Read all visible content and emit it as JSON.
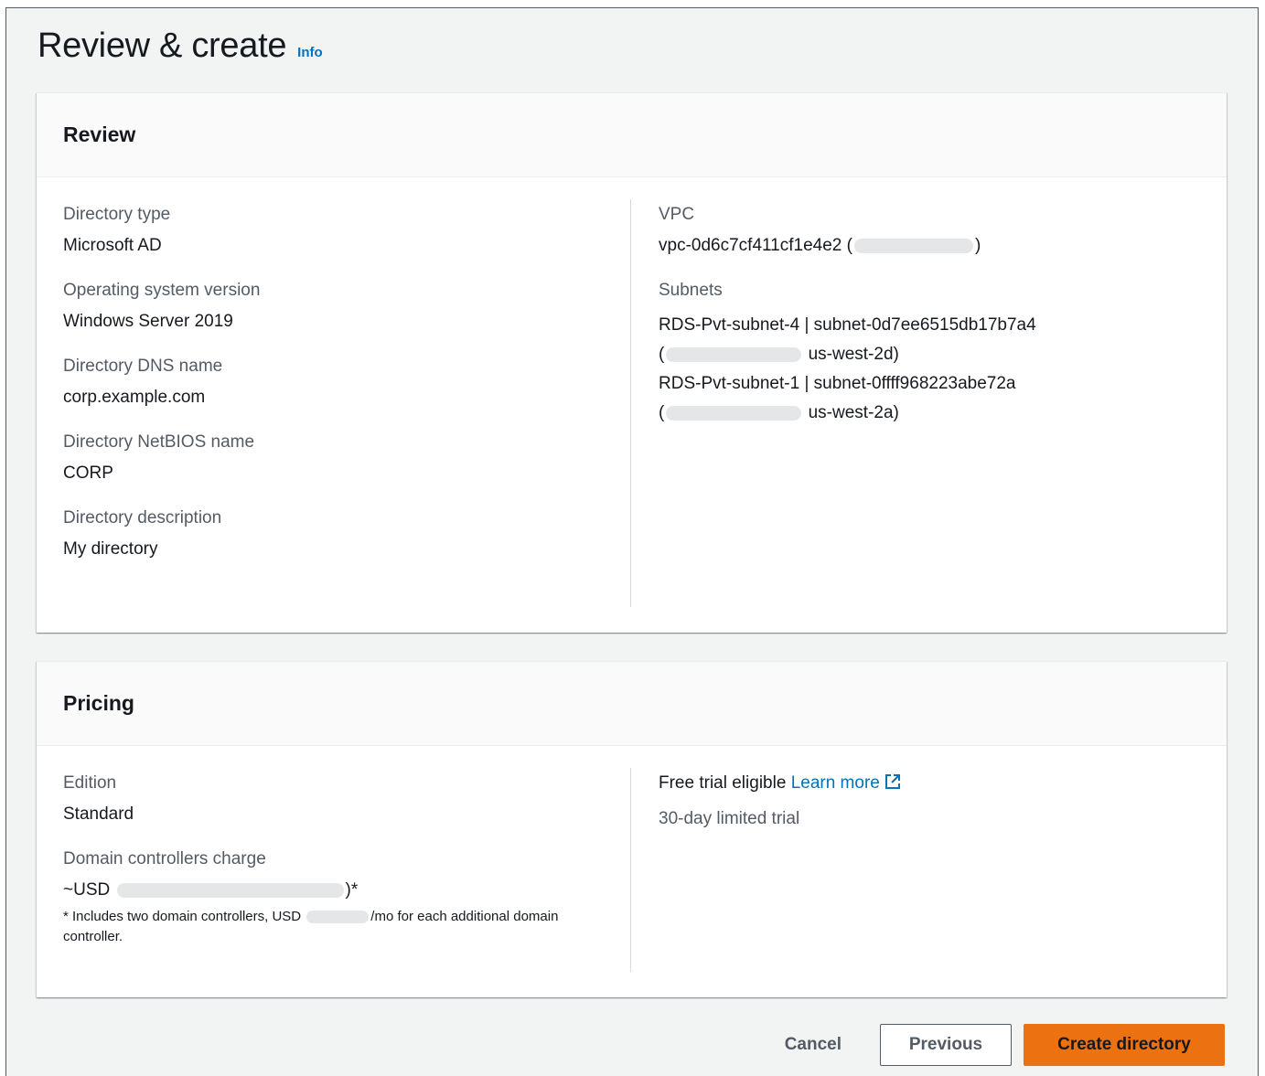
{
  "page": {
    "title": "Review & create",
    "info_label": "Info"
  },
  "review": {
    "title": "Review",
    "left": [
      {
        "label": "Directory type",
        "value": "Microsoft AD"
      },
      {
        "label": "Operating system version",
        "value": "Windows Server 2019"
      },
      {
        "label": "Directory DNS name",
        "value": "corp.example.com"
      },
      {
        "label": "Directory NetBIOS name",
        "value": "CORP"
      },
      {
        "label": "Directory description",
        "value": "My directory"
      }
    ],
    "vpc": {
      "label": "VPC",
      "value_prefix": "vpc-0d6c7cf411cf1e4e2 (",
      "value_suffix": ")"
    },
    "subnets": {
      "label": "Subnets",
      "items": [
        {
          "line1": "RDS-Pvt-subnet-4 | subnet-0d7ee6515db17b7a4",
          "open_paren": "(",
          "zone": "us-west-2d)"
        },
        {
          "line1": "RDS-Pvt-subnet-1 | subnet-0ffff968223abe72a",
          "open_paren": "(",
          "zone": "us-west-2a)"
        }
      ]
    }
  },
  "pricing": {
    "title": "Pricing",
    "edition_label": "Edition",
    "edition_value": "Standard",
    "charge_label": "Domain controllers charge",
    "charge_prefix": "~USD",
    "charge_suffix": ")*",
    "footnote_prefix": "* Includes two domain controllers, USD",
    "footnote_suffix": "/mo for each additional domain controller.",
    "free_trial_text": "Free trial eligible",
    "learn_more": "Learn more",
    "trial_note": "30-day limited trial",
    "external_icon": "external-link-icon"
  },
  "actions": {
    "cancel": "Cancel",
    "previous": "Previous",
    "create": "Create directory"
  },
  "colors": {
    "primary_button": "#ec7211",
    "link": "#0073bb",
    "background": "#f2f3f3"
  }
}
